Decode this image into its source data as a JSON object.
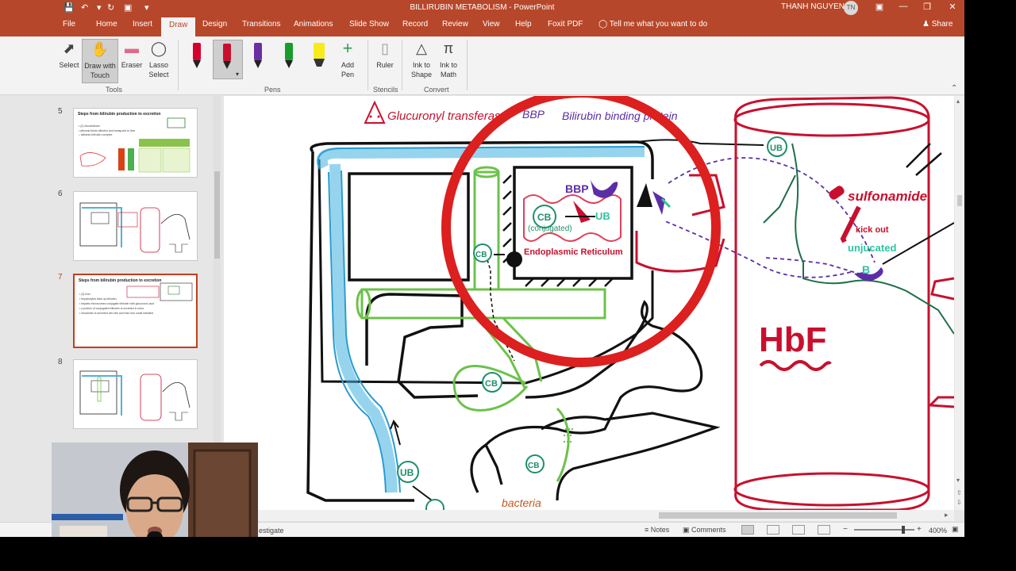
{
  "window": {
    "title": "BILLIRUBIN METABOLISM  -  PowerPoint",
    "user_name": "THANH NGUYEN",
    "user_initials": "TN"
  },
  "tabs": [
    "File",
    "Home",
    "Insert",
    "Draw",
    "Design",
    "Transitions",
    "Animations",
    "Slide Show",
    "Record",
    "Review",
    "View",
    "Help",
    "Foxit PDF"
  ],
  "active_tab": "Draw",
  "tell_me": "Tell me what you want to do",
  "share": "Share",
  "ribbon": {
    "tools": {
      "select": "Select",
      "draw_with_touch_1": "Draw with",
      "draw_with_touch_2": "Touch",
      "eraser": "Eraser",
      "lasso_1": "Lasso",
      "lasso_2": "Select",
      "group": "Tools"
    },
    "pens": {
      "group": "Pens",
      "add_pen_1": "Add",
      "add_pen_2": "Pen",
      "colors": [
        "#d6002f",
        "#c8102e",
        "#6a2fa3",
        "#1a9c2a",
        "#f7ec1a"
      ]
    },
    "stencils": {
      "ruler": "Ruler",
      "group": "Stencils"
    },
    "convert": {
      "ink_to_shape_1": "Ink to",
      "ink_to_shape_2": "Shape",
      "ink_to_math_1": "Ink to",
      "ink_to_math_2": "Math",
      "group": "Convert"
    }
  },
  "thumbnails": [
    {
      "number": "5",
      "title": "Steps from bilirubin production to excretion",
      "lines": [
        "• (2) bloodstream",
        "  • albumin binds bilirubin and transports to liver",
        "    – albumin-bilirubin complex"
      ]
    },
    {
      "number": "6"
    },
    {
      "number": "7",
      "title": "Steps from bilirubin production to excretion",
      "lines": [
        "• (3) liver",
        "  • hepatocytes take up bilirubin",
        "  • hepatic microsomes conjugate bilirubin with glucuronic acid",
        "  • a portion of conjugated bilirubin is excreted in urine",
        "  • remainder is secreted into bile and then into small intestine"
      ],
      "active": true
    },
    {
      "number": "8"
    }
  ],
  "slide": {
    "legend_glucuronyl": "Glucuronyl transferase",
    "legend_bbp": "BBP",
    "legend_binding": "Bilirubin binding protein",
    "label_bbp": "BBP",
    "label_ub": "UB",
    "label_cb": "CB",
    "label_conjugated": "(conjugated)",
    "label_er": "Endoplasmic Reticulum",
    "label_sulfonamide": "sulfonamide",
    "label_kick_out": "kick out",
    "label_unjucated": "unjucated",
    "label_b": "B",
    "label_hbf": "HbF",
    "label_bacteria": "bacteria"
  },
  "status": {
    "left_text": "estigate",
    "notes": "Notes",
    "comments": "Comments",
    "zoom": "400%"
  }
}
